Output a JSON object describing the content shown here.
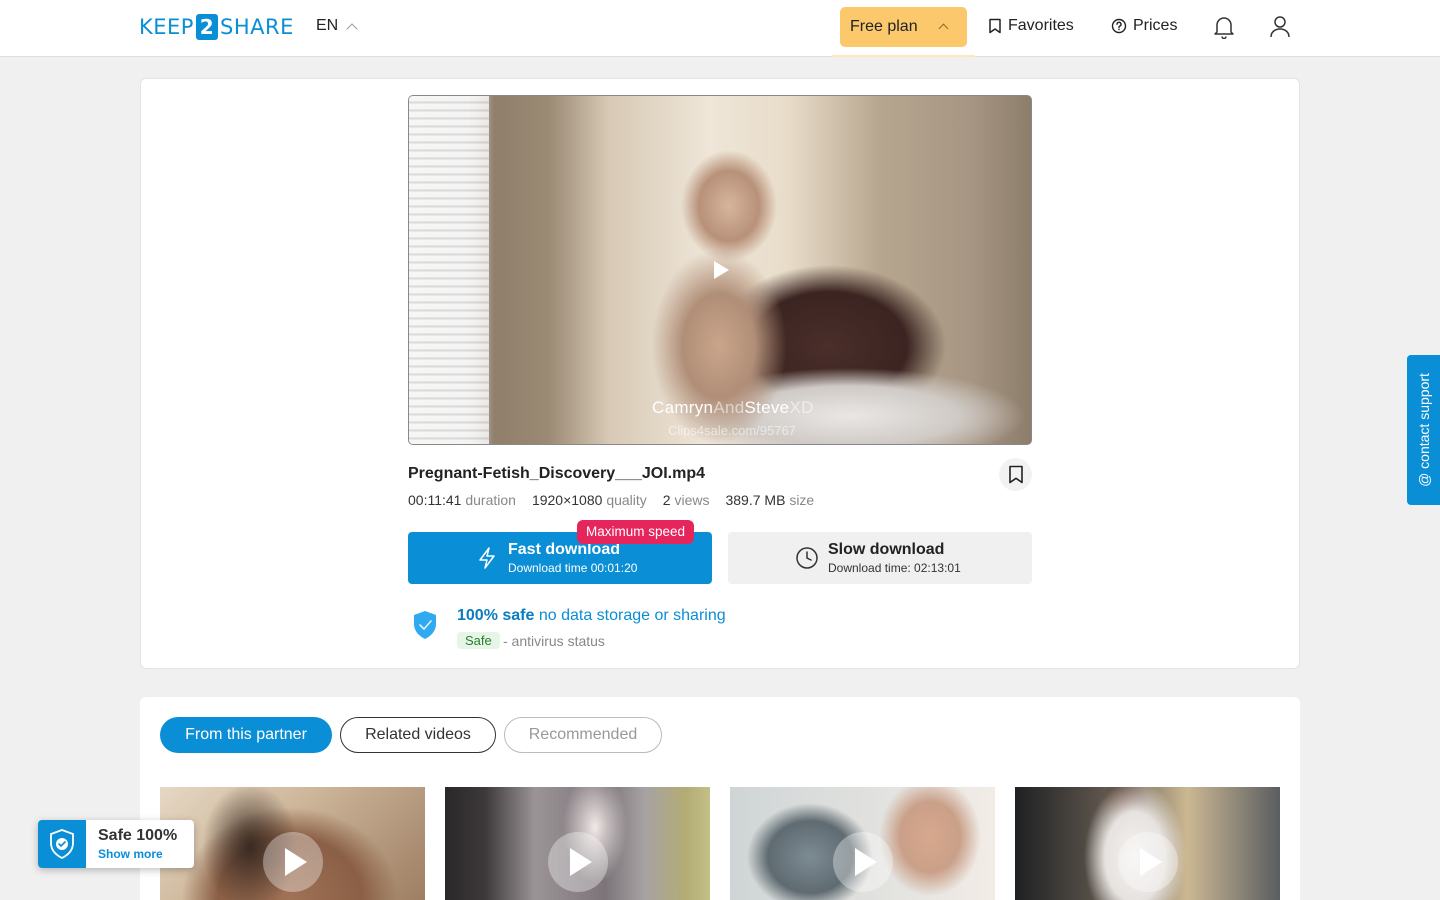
{
  "header": {
    "logo_left": "KEEP",
    "logo_mid": "2",
    "logo_right": "SHARE",
    "lang": "EN",
    "plan_label": "Free plan",
    "favorites_label": "Favorites",
    "prices_label": "Prices"
  },
  "video": {
    "watermark_main_a": "Camryn",
    "watermark_main_b": "And",
    "watermark_main_c": "Steve",
    "watermark_main_d": "XD",
    "watermark_sub": "Clips4sale.com/95767"
  },
  "file": {
    "name": "Pregnant-Fetish_Discovery___JOI.mp4",
    "duration_value": "00:11:41",
    "duration_label": "duration",
    "quality_value": "1920×1080",
    "quality_label": "quality",
    "views_value": "2",
    "views_label": "views",
    "size_value": "389.7 MB",
    "size_label": "size"
  },
  "download": {
    "badge": "Maximum speed",
    "fast_title": "Fast download",
    "fast_sub": "Download time 00:01:20",
    "slow_title": "Slow download",
    "slow_sub": "Download time: 02:13:01"
  },
  "safety": {
    "bold": "100% safe",
    "rest": " no data storage or sharing",
    "tag": "Safe",
    "status": "- antivirus status"
  },
  "tabs": [
    {
      "label": "From this partner",
      "active": true
    },
    {
      "label": "Related videos",
      "active": false
    },
    {
      "label": "Recommended",
      "active": false
    }
  ],
  "safe_widget": {
    "title": "Safe 100%",
    "link": "Show more"
  },
  "contact": {
    "label": "@ contact support"
  },
  "colors": {
    "accent": "#0a8ed6",
    "plan": "#fbc96b",
    "badge": "#e5255b"
  }
}
